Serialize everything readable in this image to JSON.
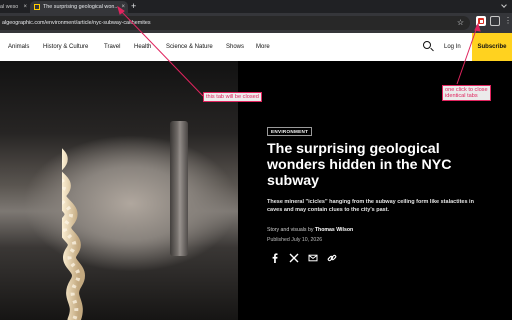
{
  "browser": {
    "tabs": [
      {
        "title": "al weso",
        "close": "×"
      },
      {
        "title": "The surprising geological won...",
        "close": "×"
      }
    ],
    "new_tab": "+",
    "url": "algeographic.com/environment/article/nyc-subway-calthemites",
    "star": "☆",
    "menu": "⋮"
  },
  "site": {
    "nav": [
      "Animals",
      "History & Culture",
      "Travel",
      "Health",
      "Science & Nature",
      "Shows",
      "More"
    ],
    "login": "Log In",
    "subscribe": "Subscribe"
  },
  "article": {
    "kicker": "ENVIRONMENT",
    "headline": "The surprising geological wonders hidden in the NYC subway",
    "dek": "These mineral \"icicles\" hanging from the subway ceiling form like stalactites in caves and may contain clues to the city's past.",
    "byline_prefix": "Story and visuals by",
    "author": "Thomas Wilson",
    "published": "Published July 10, 2026",
    "share": [
      "facebook-icon",
      "x-icon",
      "email-icon",
      "link-icon"
    ]
  },
  "annotations": {
    "tab_closed": "this tab will be closed",
    "one_click": [
      "one click to close",
      "identical tabs"
    ],
    "color": "#e0245e"
  },
  "colors": {
    "tabstrip": "#202124",
    "toolbar": "#35363a",
    "subscribe": "#ffd21f",
    "hero": "#000000"
  }
}
